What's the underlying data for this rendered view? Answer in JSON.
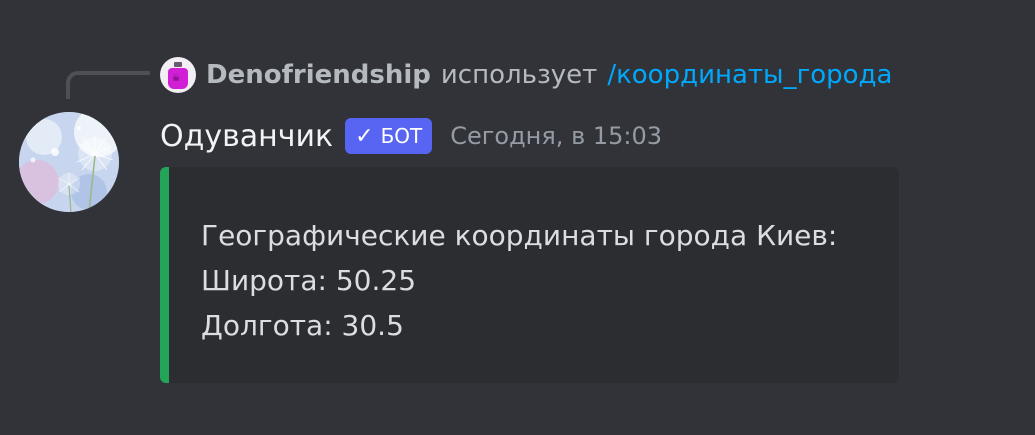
{
  "reply": {
    "username": "Denofriendship",
    "action_text": "использует",
    "command": "/координаты_города",
    "avatar_icon": "magenta-bottle-avatar"
  },
  "message": {
    "author": "Одуванчик",
    "bot_tag": "БОТ",
    "bot_tag_icon": "check-icon",
    "timestamp": "Сегодня, в 15:03",
    "avatar_icon": "dandelion-avatar"
  },
  "embed": {
    "accent_color": "#23a559",
    "lines": [
      "Географические координаты города Киев:",
      "Широта: 50.25",
      "Долгота: 30.5"
    ]
  },
  "colors": {
    "background": "#313338",
    "embed_background": "#2b2d31",
    "link": "#00a8fc",
    "bot_tag": "#5865f2"
  }
}
